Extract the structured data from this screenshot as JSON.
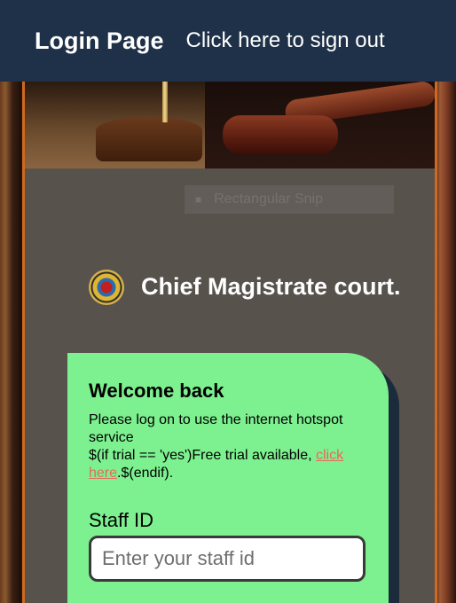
{
  "header": {
    "title": "Login Page",
    "signout": "Click here to sign out"
  },
  "ghost_tooltip": {
    "label": "Rectangular Snip"
  },
  "brand": {
    "name": "Chief Magistrate court."
  },
  "login": {
    "welcome": "Welcome back",
    "desc_line1": "Please log on to use the internet hotspot service",
    "desc_prefix": "$(if trial == 'yes')Free trial available, ",
    "desc_link": "click here",
    "desc_suffix": ".$(endif).",
    "staff_label": "Staff ID",
    "staff_placeholder": "Enter your staff id"
  },
  "colors": {
    "topbar": "#1f3148",
    "frame_border": "#d0691e",
    "panel": "#58524d",
    "card": "#7df090",
    "link": "#e86a5a"
  }
}
